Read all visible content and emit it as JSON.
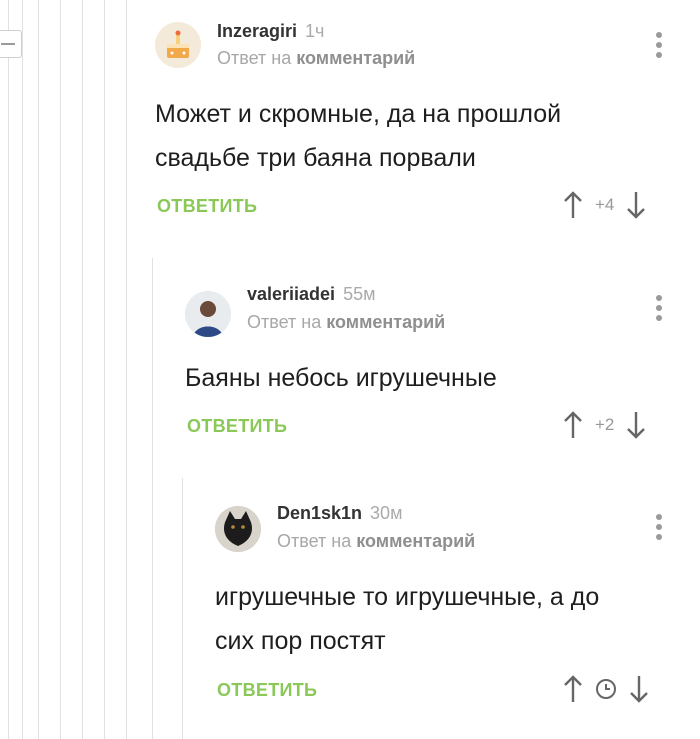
{
  "comments": [
    {
      "author": "Inzeragiri",
      "time": "1ч",
      "reply_prefix": "Ответ на",
      "reply_target": "комментарий",
      "text_lines": [
        "Может и скромные, да на прошлой",
        "свадьбе три баяна порвали"
      ],
      "reply_label": "ОТВЕТИТЬ",
      "score": "+4",
      "avatar_icon": "avatar-cake-icon"
    },
    {
      "author": "valeriiadei",
      "time": "55м",
      "reply_prefix": "Ответ на",
      "reply_target": "комментарий",
      "text_lines": [
        "Баяны небось игрушечные"
      ],
      "reply_label": "ОТВЕТИТЬ",
      "score": "+2",
      "avatar_icon": "avatar-person-icon"
    },
    {
      "author": "Den1sk1n",
      "time": "30м",
      "reply_prefix": "Ответ на",
      "reply_target": "комментарий",
      "text_lines": [
        "игрушечные то игрушечные, а до",
        "сих пор постят"
      ],
      "reply_label": "ОТВЕТИТЬ",
      "score_icon": "clock-icon",
      "avatar_icon": "avatar-cat-icon"
    }
  ],
  "colors": {
    "reply_green": "#8ac858",
    "meta_gray": "#a7a7a7",
    "thread_line": "#e2e2e2"
  }
}
